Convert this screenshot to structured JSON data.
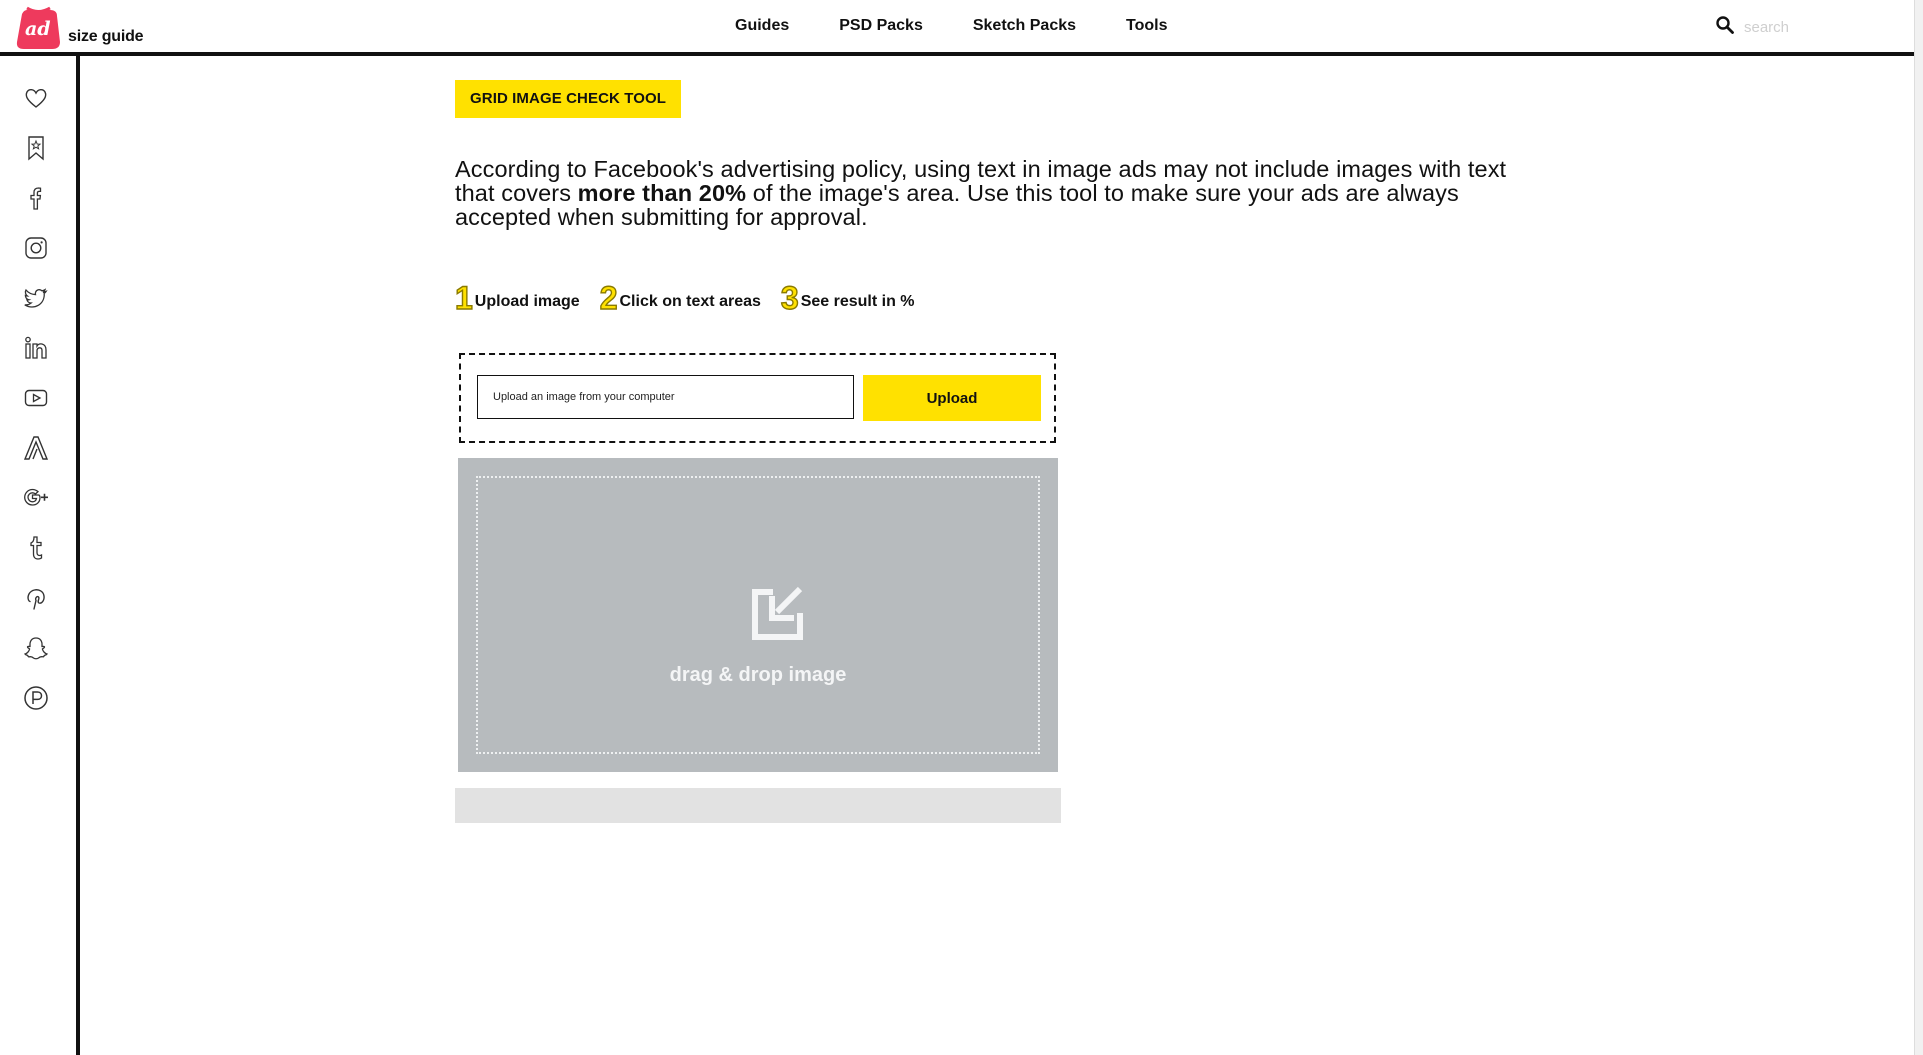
{
  "header": {
    "logo_mark_text": "ad",
    "logo_text": "size guide",
    "nav": [
      {
        "label": "Guides"
      },
      {
        "label": "PSD Packs"
      },
      {
        "label": "Sketch Packs"
      },
      {
        "label": "Tools"
      }
    ],
    "search_placeholder": "search",
    "search_icon": "search-icon"
  },
  "sidebar": {
    "icons": [
      "heart-icon",
      "bookmark-star-icon",
      "facebook-icon",
      "instagram-icon",
      "twitter-icon",
      "linkedin-icon",
      "youtube-icon",
      "adwords-icon",
      "google-plus-icon",
      "tumblr-icon",
      "pinterest-icon",
      "snapchat-icon",
      "producthunt-icon"
    ]
  },
  "main": {
    "badge": "GRID IMAGE CHECK TOOL",
    "intro_before": "According to Facebook's advertising policy, using text in image ads may not include images with text that covers ",
    "intro_bold": "more than 20%",
    "intro_after": " of the image's area. Use this tool to make sure your ads are always accepted when submitting for approval.",
    "steps": [
      {
        "num": "1",
        "label": "Upload image"
      },
      {
        "num": "2",
        "label": "Click on text areas"
      },
      {
        "num": "3",
        "label": "See result in %"
      }
    ],
    "upload_placeholder": "Upload an image from your computer",
    "upload_button": "Upload",
    "drop_label": "drag & drop image",
    "drop_icon": "drop-arrow-icon"
  },
  "colors": {
    "accent": "#ffe100",
    "logo": "#ee3a5d",
    "drop_zone": "#b7bbbe",
    "result_bar": "#e2e2e2"
  }
}
